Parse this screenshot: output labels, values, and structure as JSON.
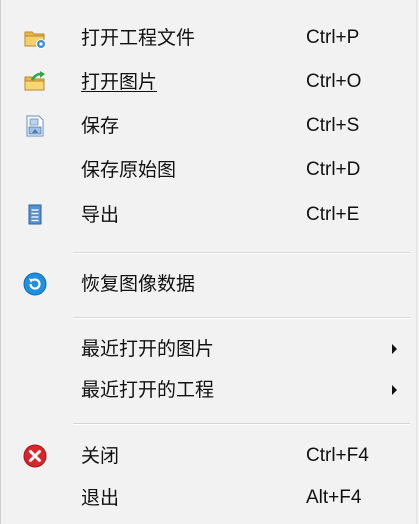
{
  "menu": {
    "items": [
      {
        "label": "打开工程文件",
        "shortcut": "Ctrl+P",
        "icon": "open-project-icon"
      },
      {
        "label": "打开图片",
        "shortcut": "Ctrl+O",
        "icon": "open-image-icon"
      },
      {
        "label": "保存",
        "shortcut": "Ctrl+S",
        "icon": "save-icon"
      },
      {
        "label": "保存原始图",
        "shortcut": "Ctrl+D",
        "icon": ""
      },
      {
        "label": "导出",
        "shortcut": "Ctrl+E",
        "icon": "export-icon"
      },
      {
        "label": "恢复图像数据",
        "shortcut": "",
        "icon": "restore-icon"
      },
      {
        "label": "最近打开的图片",
        "shortcut": "",
        "icon": "",
        "submenu": true
      },
      {
        "label": "最近打开的工程",
        "shortcut": "",
        "icon": "",
        "submenu": true
      },
      {
        "label": "关闭",
        "shortcut": "Ctrl+F4",
        "icon": "close-icon"
      },
      {
        "label": "退出",
        "shortcut": "Alt+F4",
        "icon": ""
      }
    ]
  },
  "colors": {
    "background": "#f2f2f2",
    "separator": "#d6d6d6",
    "text": "#111111",
    "folder": "#e8b84a",
    "restore_blue": "#1f8fe0",
    "close_red": "#d8262a"
  }
}
